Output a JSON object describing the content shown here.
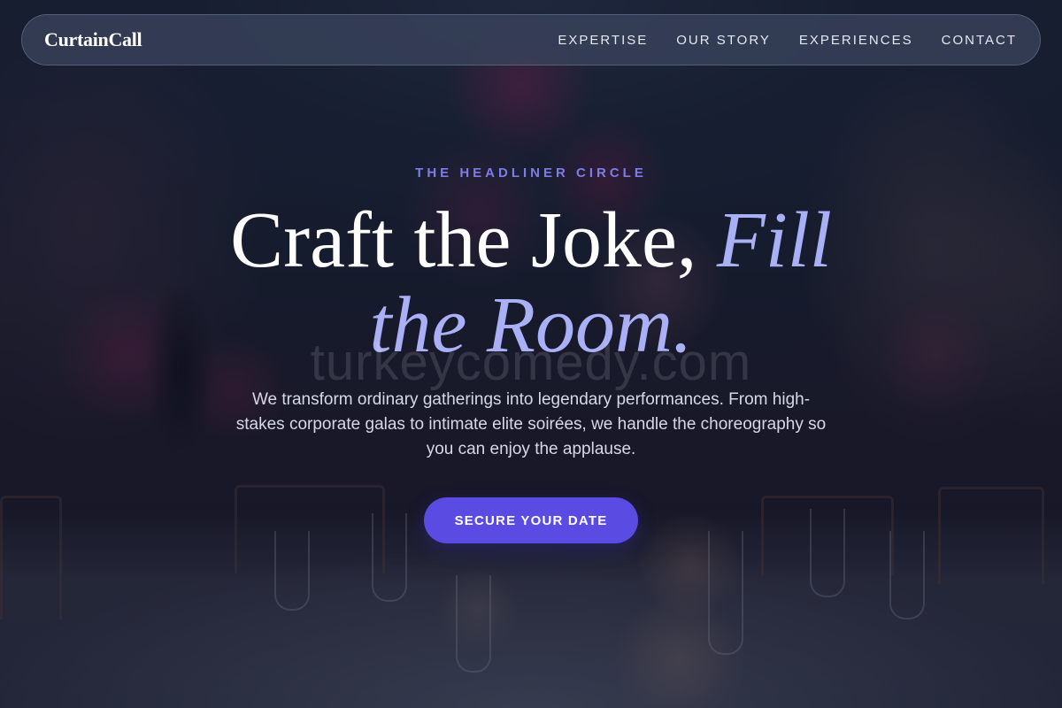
{
  "header": {
    "brand": "CurtainCall",
    "nav": [
      {
        "label": "EXPERTISE"
      },
      {
        "label": "OUR STORY"
      },
      {
        "label": "EXPERIENCES"
      },
      {
        "label": "CONTACT"
      }
    ]
  },
  "hero": {
    "eyebrow": "THE HEADLINER CIRCLE",
    "headline_plain": "Craft the Joke, ",
    "headline_accent": "Fill the Room.",
    "subtext": "We transform ordinary gatherings into legendary performances. From high-stakes corporate galas to intimate elite soirées, we handle the choreography so you can enjoy the applause.",
    "cta_label": "SECURE YOUR DATE",
    "watermark": "turkeycomedy.com"
  },
  "colors": {
    "accent": "#5a4be3",
    "eyebrow": "#7b7ee6",
    "headline_accent": "#aab0f6"
  }
}
